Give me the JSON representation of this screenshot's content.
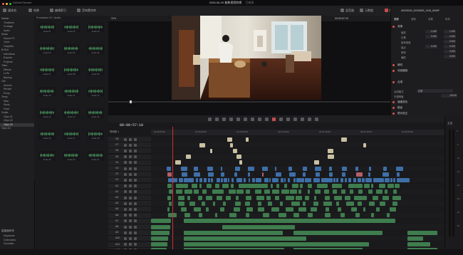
{
  "window": {
    "title": "2025-06-29 抽象视频剪辑",
    "title_suffix": "已修改",
    "app_name": "DaVinci Resolve"
  },
  "toolbar": {
    "items": [
      "媒体池",
      "效果",
      "编辑索引",
      "音响素材库"
    ],
    "right_items": [
      "混音器",
      "元数据",
      "检查器"
    ]
  },
  "mediapool": {
    "bins": [
      "Master",
      "Timelines",
      "Footage",
      "Audio",
      "Music",
      "Sound FX",
      "Voice",
      "Graphics",
      "B-Roll",
      "Interviews",
      "Exports",
      "Projects",
      "Titles",
      "Effects",
      "LUTs",
      "Backup",
      "Old",
      "Archive",
      "Render",
      "Proxy",
      "Temp",
      "Misc",
      "Stock",
      "Final",
      "Drafts",
      "Clips 01",
      "Clips 02",
      "Clips 03",
      "Clips 04"
    ],
    "selected_index": 27,
    "smart_bins_label": "智能媒体夹",
    "smart_bins": [
      "Keywords",
      "Collections",
      "Favorites"
    ]
  },
  "clip_grid": {
    "header": "Production 01 / Audio",
    "clips": [
      "Audio 01",
      "Audio 02",
      "Audio 03",
      "Audio 04",
      "Audio 05",
      "Audio 06",
      "Audio 07",
      "Audio 08",
      "Audio 09",
      "Audio 10",
      "Audio 11",
      "Audio 12",
      "Audio 13",
      "Audio 14",
      "Audio 15",
      "Audio 16",
      "Audio 17",
      "Audio 18",
      "Audio 19",
      "Audio 20",
      "Audio 21"
    ]
  },
  "viewer": {
    "zoom": "33%",
    "clip_name": "编辑时间线 01",
    "timecode_right": "00:00:57:10"
  },
  "inspector": {
    "clip_name": "A0025040_20250629_1345_4K60P",
    "tabs": [
      "视频",
      "音频",
      "效果",
      "转场"
    ],
    "transform_label": "变换",
    "rows": [
      {
        "label": "缩放",
        "x": "1.000",
        "y": "1.000"
      },
      {
        "label": "位置",
        "x": "0.000",
        "y": "0.000"
      },
      {
        "label": "旋转角度",
        "x": "",
        "y": "0.000"
      },
      {
        "label": "锚点",
        "x": "0.000",
        "y": "0.000"
      },
      {
        "label": "俯仰",
        "x": "",
        "y": "0.000"
      },
      {
        "label": "偏航",
        "x": "",
        "y": "0.000"
      }
    ],
    "sections": [
      "裁切",
      "动态缩放",
      "合成",
      "速度变化",
      "稳定",
      "镜头校正",
      "图像缩放"
    ],
    "composite_mode_label": "合成模式",
    "composite_mode_value": "正常",
    "opacity_label": "不透明度",
    "opacity_value": "100.00"
  },
  "timeline": {
    "timecode": "00:00:57:10",
    "timeline_name": "时间线 1",
    "video_tracks": [
      "V8",
      "V7",
      "V6",
      "V5",
      "V4",
      "V3",
      "V2",
      "V1"
    ],
    "audio_tracks": [
      "A1",
      "A2",
      "A3",
      "A4",
      "A5",
      "A6",
      "A7",
      "A8",
      "A9",
      "A10",
      "A11",
      "A12"
    ],
    "ruler_ticks": [
      "01:00:00:00",
      "01:00:20:00",
      "01:00:40:00",
      "01:01:00:00",
      "01:01:20:00",
      "01:01:40:00",
      "01:02:00:00"
    ],
    "colors": {
      "video": "#3e6fa8",
      "audio": "#3f7d4e",
      "title": "#c9c0a2",
      "pink": "#b45f68",
      "blue_clip": "#2348a8"
    }
  },
  "meters": {
    "label": "主控",
    "scale": [
      "0",
      "-5",
      "-10",
      "-15",
      "-20",
      "-30",
      "-40",
      "-50"
    ]
  }
}
